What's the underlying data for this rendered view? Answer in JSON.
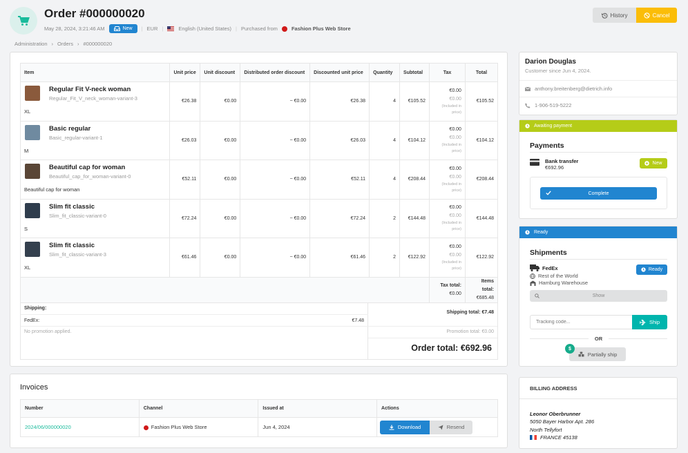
{
  "order": {
    "title": "Order #000000020",
    "date": "May 28, 2024, 3:21:46 AM",
    "state": "New",
    "currency": "EUR",
    "locale": "English (United States)",
    "purchased_from": "Purchased from",
    "shop": "Fashion Plus Web Store"
  },
  "actions": {
    "history": "History",
    "cancel": "Cancel"
  },
  "breadcrumb": [
    "Administration",
    "Orders",
    "#000000020"
  ],
  "items_table": {
    "headers": [
      "Item",
      "Unit price",
      "Unit discount",
      "Distributed order discount",
      "Discounted unit price",
      "Quantity",
      "Subtotal",
      "Tax",
      "Total"
    ],
    "rows": [
      {
        "name": "Regular Fit V-neck woman",
        "variant": "Regular_Fit_V_neck_woman-variant-3",
        "option": "XL",
        "unit_price": "€26.38",
        "unit_discount": "€0.00",
        "distributed": "~ €0.00",
        "discounted": "€26.38",
        "qty": "4",
        "subtotal": "€105.52",
        "tax1": "€0.00",
        "tax2": "€0.00",
        "tax_note": "(Included in price)",
        "total": "€105.52",
        "img": "#8a5a3c"
      },
      {
        "name": "Basic regular",
        "variant": "Basic_regular-variant-1",
        "option": "M",
        "unit_price": "€26.03",
        "unit_discount": "€0.00",
        "distributed": "~ €0.00",
        "discounted": "€26.03",
        "qty": "4",
        "subtotal": "€104.12",
        "tax1": "€0.00",
        "tax2": "€0.00",
        "tax_note": "(Included in price)",
        "total": "€104.12",
        "img": "#6f8aa0"
      },
      {
        "name": "Beautiful cap for woman",
        "variant": "Beautiful_cap_for_woman-variant-0",
        "option": "Beautiful cap for woman",
        "unit_price": "€52.11",
        "unit_discount": "€0.00",
        "distributed": "~ €0.00",
        "discounted": "€52.11",
        "qty": "4",
        "subtotal": "€208.44",
        "tax1": "€0.00",
        "tax2": "€0.00",
        "tax_note": "(Included in price)",
        "total": "€208.44",
        "img": "#5a4636"
      },
      {
        "name": "Slim fit classic",
        "variant": "Slim_fit_classic-variant-0",
        "option": "S",
        "unit_price": "€72.24",
        "unit_discount": "€0.00",
        "distributed": "~ €0.00",
        "discounted": "€72.24",
        "qty": "2",
        "subtotal": "€144.48",
        "tax1": "€0.00",
        "tax2": "€0.00",
        "tax_note": "(Included in price)",
        "total": "€144.48",
        "img": "#2f3d4d"
      },
      {
        "name": "Slim fit classic",
        "variant": "Slim_fit_classic-variant-3",
        "option": "XL",
        "unit_price": "€61.46",
        "unit_discount": "€0.00",
        "distributed": "~ €0.00",
        "discounted": "€61.46",
        "qty": "2",
        "subtotal": "€122.92",
        "tax1": "€0.00",
        "tax2": "€0.00",
        "tax_note": "(Included in price)",
        "total": "€122.92",
        "img": "#34404e"
      }
    ],
    "tax_total_label": "Tax total:",
    "tax_total": "€0.00",
    "items_total_label": "Items total:",
    "items_total": "€685.48"
  },
  "summary": {
    "shipping_label": "Shipping:",
    "carrier": "FedEx:",
    "carrier_amount": "€7.48",
    "shipping_total": "Shipping total: €7.48",
    "no_promo": "No promotion applied.",
    "promo_total": "Promotion total: €0.00",
    "order_total": "Order total: €692.96"
  },
  "customer": {
    "name": "Darion Douglas",
    "since": "Customer since Jun 4, 2024.",
    "email": "anthony.breitenberg@dietrich.info",
    "phone": "1-906-519-5222"
  },
  "payment": {
    "state_bar": "Awaiting payment",
    "heading": "Payments",
    "method": "Bank transfer",
    "amount": "€692.96",
    "badge": "New",
    "complete": "Complete"
  },
  "shipment": {
    "state_bar": "Ready",
    "heading": "Shipments",
    "method": "FedEx",
    "zone": "Rest of the World",
    "warehouse": "Hamburg Warehouse",
    "badge": "Ready",
    "show": "Show",
    "tracking_placeholder": "Tracking code...",
    "ship": "Ship",
    "or": "OR",
    "partial": "Partially ship"
  },
  "billing": {
    "heading": "BILLING ADDRESS",
    "name": "Leonor Oberbrunner",
    "street": "5050 Bayer Harbor Apt. 286",
    "city": "North Tellyfort",
    "country": "FRANCE 45138"
  },
  "invoices": {
    "heading": "Invoices",
    "headers": [
      "Number",
      "Channel",
      "Issued at",
      "Actions"
    ],
    "row": {
      "number": "2024/06/000000020",
      "channel": "Fashion Plus Web Store",
      "issued": "Jun 4, 2024"
    },
    "download": "Download",
    "resend": "Resend"
  },
  "colors": {
    "teal": "#1abb9c",
    "blue": "#2185d0",
    "olive": "#b5cc18",
    "yellow": "#fbbd08"
  }
}
